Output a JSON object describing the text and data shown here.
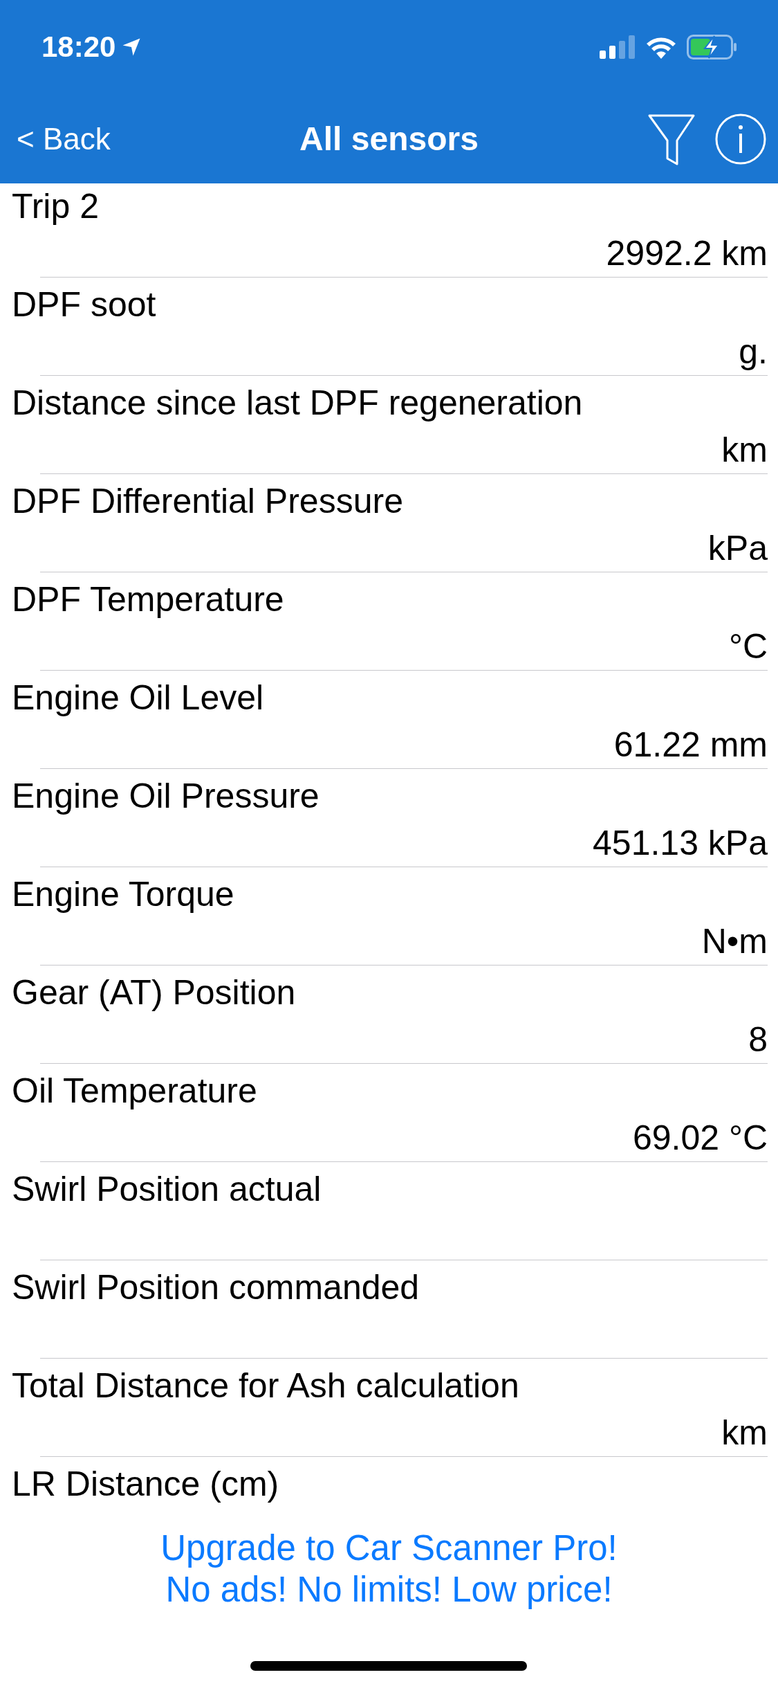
{
  "status_bar": {
    "time": "18:20"
  },
  "nav": {
    "back": "< Back",
    "title": "All sensors"
  },
  "sensors": [
    {
      "name": "Trip 2",
      "value": "2992.2 km"
    },
    {
      "name": "DPF soot",
      "value": "g."
    },
    {
      "name": "Distance since last DPF regeneration",
      "value": "km"
    },
    {
      "name": "DPF Differential Pressure",
      "value": "kPa"
    },
    {
      "name": "DPF Temperature",
      "value": "°C"
    },
    {
      "name": "Engine Oil Level",
      "value": "61.22 mm"
    },
    {
      "name": "Engine Oil Pressure",
      "value": "451.13 kPa"
    },
    {
      "name": "Engine Torque",
      "value": "N•m"
    },
    {
      "name": "Gear (AT) Position",
      "value": "8"
    },
    {
      "name": "Oil Temperature",
      "value": "69.02 °C"
    },
    {
      "name": "Swirl Position actual"
    },
    {
      "name": "Swirl Position commanded"
    },
    {
      "name": "Total Distance for Ash calculation",
      "value": "km"
    },
    {
      "name": "LR Distance (cm)"
    }
  ],
  "promo": [
    "Upgrade to Car Scanner Pro!",
    "No ads! No limits! Low price!"
  ]
}
